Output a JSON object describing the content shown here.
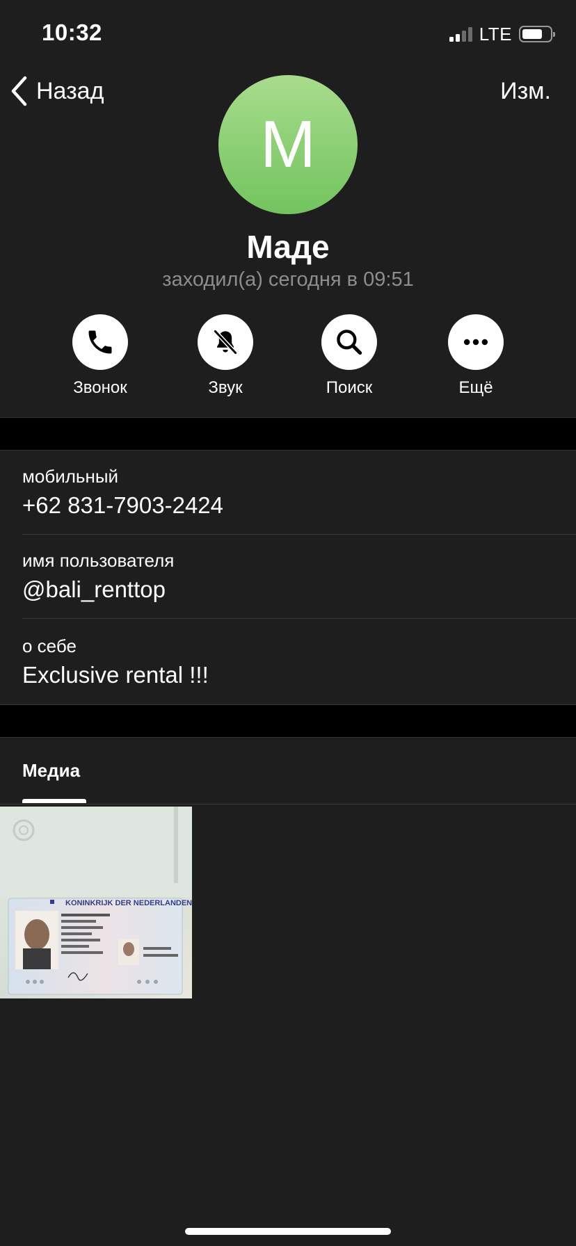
{
  "status_bar": {
    "time": "10:32",
    "network": "LTE"
  },
  "nav": {
    "back_label": "Назад",
    "edit_label": "Изм."
  },
  "profile": {
    "avatar_letter": "M",
    "avatar_colors": [
      "#a8dc8c",
      "#72c45f"
    ],
    "name": "Маде",
    "last_seen": "заходил(а) сегодня в 09:51"
  },
  "actions": [
    {
      "label": "Звонок",
      "icon": "phone-icon"
    },
    {
      "label": "Звук",
      "icon": "bell-slash-icon"
    },
    {
      "label": "Поиск",
      "icon": "search-icon"
    },
    {
      "label": "Ещё",
      "icon": "more-icon"
    }
  ],
  "info": {
    "mobile": {
      "caption": "мобильный",
      "value": "+62 831-7903-2424"
    },
    "username": {
      "caption": "имя пользователя",
      "value": "@bali_renttop"
    },
    "bio": {
      "caption": "о себе",
      "value": "Exclusive rental !!!"
    }
  },
  "media": {
    "title": "Медиа",
    "items": [
      {
        "kind": "photo",
        "doc_header": "KONINKRIJK DER NEDERLANDEN"
      }
    ]
  }
}
